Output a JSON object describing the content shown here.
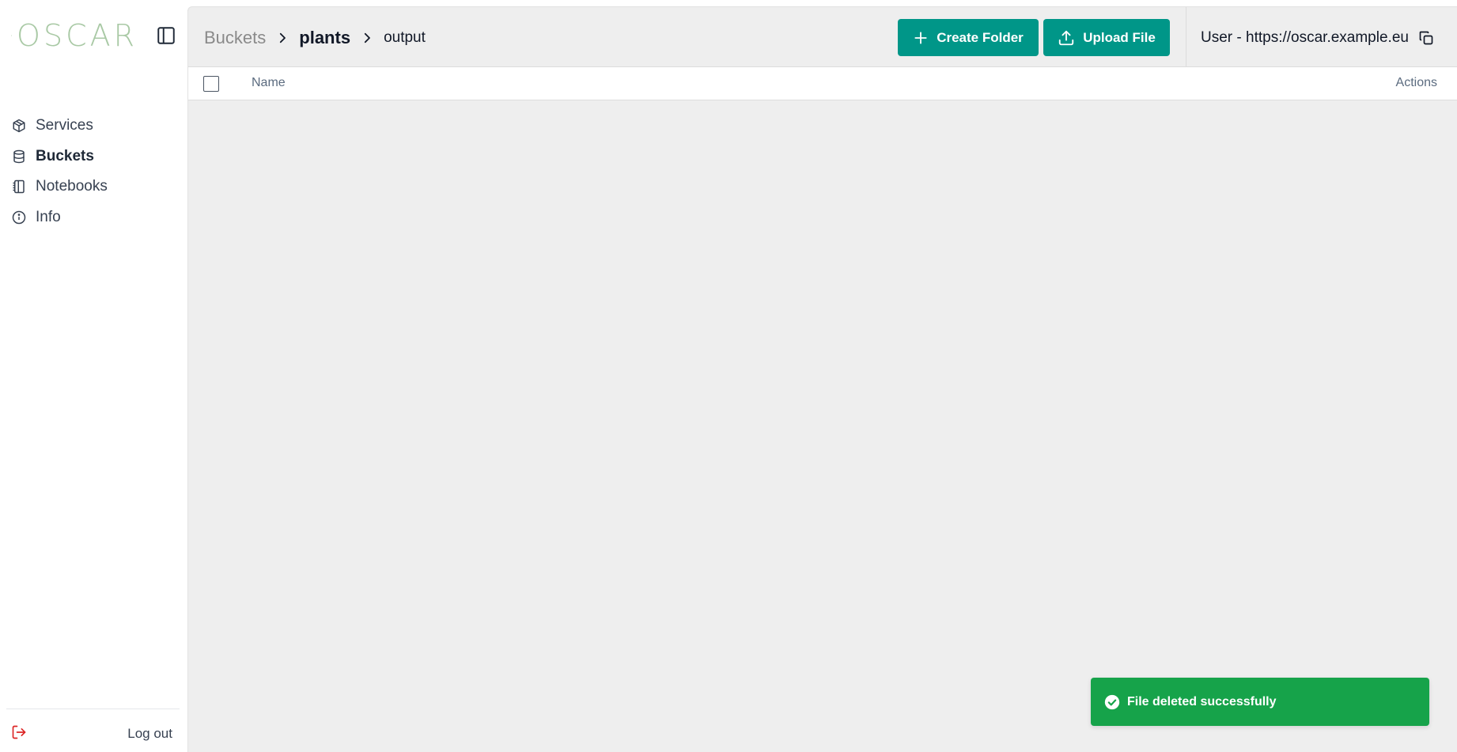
{
  "app": {
    "logo_text": "OSCAR",
    "colors": {
      "primary": "#009688",
      "success": "#16a34a",
      "danger": "#dc2626",
      "logo": "#a9c9a5"
    }
  },
  "sidebar": {
    "items": [
      {
        "label": "Services",
        "icon": "package-icon",
        "active": false
      },
      {
        "label": "Buckets",
        "icon": "database-icon",
        "active": true
      },
      {
        "label": "Notebooks",
        "icon": "notebook-icon",
        "active": false
      },
      {
        "label": "Info",
        "icon": "info-icon",
        "active": false
      }
    ],
    "logout_label": "Log out"
  },
  "header": {
    "breadcrumb": [
      "Buckets",
      "plants",
      "output"
    ],
    "create_folder_label": "Create Folder",
    "upload_file_label": "Upload File",
    "user_label": "User - https://oscar.example.eu"
  },
  "table": {
    "columns": [
      "Name",
      "Actions"
    ],
    "rows": []
  },
  "toast": {
    "message": "File deleted successfully",
    "status": "success"
  }
}
